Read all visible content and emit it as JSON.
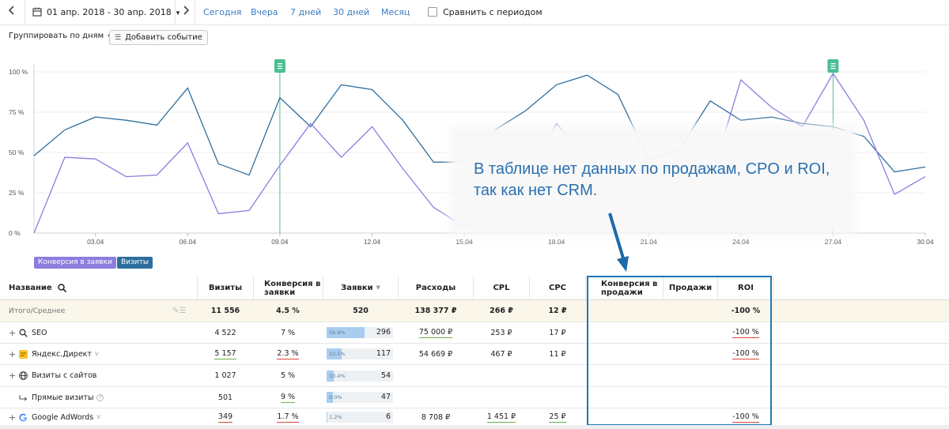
{
  "toolbar": {
    "date_range": "01 апр. 2018 - 30 апр. 2018",
    "periods": [
      "Сегодня",
      "Вчера",
      "7 дней",
      "30 дней",
      "Месяц"
    ],
    "compare_label": "Сравнить с периодом"
  },
  "controls": {
    "group_by": "Группировать по дням",
    "add_event": "Добавить событие"
  },
  "chart_data": {
    "type": "line",
    "x": [
      "01.04",
      "02.04",
      "03.04",
      "04.04",
      "05.04",
      "06.04",
      "07.04",
      "08.04",
      "09.04",
      "10.04",
      "11.04",
      "12.04",
      "13.04",
      "14.04",
      "15.04",
      "16.04",
      "17.04",
      "18.04",
      "19.04",
      "20.04",
      "21.04",
      "22.04",
      "23.04",
      "24.04",
      "25.04",
      "26.04",
      "27.04",
      "28.04",
      "29.04",
      "30.04"
    ],
    "x_tick_labels": [
      "03.04",
      "06.04",
      "09.04",
      "12.04",
      "15.04",
      "18.04",
      "21.04",
      "24.04",
      "27.04",
      "30.04"
    ],
    "y_tick_labels": [
      "100 %",
      "75 %",
      "50 %",
      "25 %",
      "0 %"
    ],
    "ylim": [
      0,
      100
    ],
    "series": [
      {
        "name": "Визиты",
        "color": "#2e6e9e",
        "values": [
          48,
          64,
          72,
          70,
          67,
          90,
          43,
          36,
          84,
          66,
          92,
          89,
          70,
          44,
          44,
          64,
          76,
          92,
          98,
          86,
          46,
          52,
          82,
          70,
          72,
          68,
          66,
          60,
          38,
          41
        ]
      },
      {
        "name": "Конверсия в заявки",
        "color": "#8c7ddf",
        "values": [
          0,
          47,
          46,
          35,
          36,
          56,
          12,
          14,
          42,
          68,
          47,
          66,
          40,
          16,
          4,
          52,
          30,
          68,
          46,
          14,
          24,
          10,
          32,
          95,
          78,
          66,
          99,
          70,
          24,
          35
        ]
      }
    ],
    "event_markers": [
      "09.04",
      "27.04"
    ],
    "grid": true
  },
  "legend": [
    {
      "label": "Конверсия в заявки",
      "color": "#8c7ddf"
    },
    {
      "label": "Визиты",
      "color": "#2e6e9e"
    }
  ],
  "note": {
    "line1": "В таблице нет данных по продажам, CPO и ROI,",
    "line2": "так как нет CRM."
  },
  "table": {
    "headers": {
      "name": "Название",
      "visits": "Визиты",
      "conv_req_1": "Конверсия в",
      "conv_req_2": "заявки",
      "requests": "Заявки",
      "costs": "Расходы",
      "cpl": "CPL",
      "cpc": "CPC",
      "conv_sales_1": "Конверсия в",
      "conv_sales_2": "продажи",
      "sales": "Продажи",
      "roi": "ROI"
    },
    "total": {
      "name": "Итого/Среднее",
      "visits": "11 556",
      "conv": "4.5 %",
      "requests": "520",
      "costs": "138 377 ₽",
      "cpl": "266 ₽",
      "cpc": "12 ₽",
      "roi": "-100 %"
    },
    "rows": [
      {
        "name": "SEO",
        "visits": "4 522",
        "conv": "7 %",
        "bar_pct": "56.9%",
        "bar_fill": 0.569,
        "requests": "296",
        "costs": "75 000 ₽",
        "cpl": "253 ₽",
        "cpc": "17 ₽",
        "roi": "-100 %"
      },
      {
        "name": "Яндекс.Директ",
        "visits": "5 157",
        "conv": "2.3 %",
        "bar_pct": "22.5%",
        "bar_fill": 0.225,
        "requests": "117",
        "costs": "54 669 ₽",
        "cpl": "467 ₽",
        "cpc": "11 ₽",
        "roi": "-100 %"
      },
      {
        "name": "Визиты с сайтов",
        "visits": "1 027",
        "conv": "5 %",
        "bar_pct": "10.4%",
        "bar_fill": 0.104,
        "requests": "54",
        "costs": "",
        "cpl": "",
        "cpc": "",
        "roi": ""
      },
      {
        "name": "Прямые визиты",
        "visits": "501",
        "conv": "9 %",
        "bar_pct": "9.0%",
        "bar_fill": 0.09,
        "requests": "47",
        "costs": "",
        "cpl": "",
        "cpc": "",
        "roi": ""
      },
      {
        "name": "Google AdWords",
        "visits": "349",
        "conv": "1.7 %",
        "bar_pct": "1.2%",
        "bar_fill": 0.012,
        "requests": "6",
        "costs": "8 708 ₽",
        "cpl": "1 451 ₽",
        "cpc": "25 ₽",
        "roi": "-100 %"
      }
    ]
  }
}
